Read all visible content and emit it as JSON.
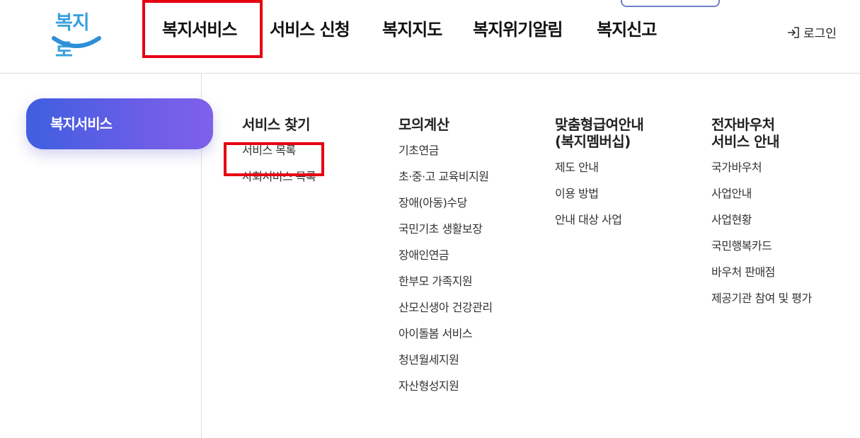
{
  "logo": {
    "text": "복지로",
    "colors": {
      "text": "#3aa0dd",
      "smile": "#2e8fd8"
    }
  },
  "gnb": {
    "items": [
      "복지서비스",
      "서비스 신청",
      "복지지도",
      "복지위기알림",
      "복지신고"
    ]
  },
  "login": {
    "label": "로그인",
    "icon": "login-arrow-icon"
  },
  "side": {
    "label": "복지서비스"
  },
  "columns": [
    {
      "title": "서비스 찾기",
      "items": [
        "서비스 목록",
        "사회서비스 목록"
      ]
    },
    {
      "title": "모의계산",
      "items": [
        "기초연금",
        "초·중·고 교육비지원",
        "장애(아동)수당",
        "국민기초 생활보장",
        "장애인연금",
        "한부모 가족지원",
        "산모신생아 건강관리",
        "아이돌봄 서비스",
        "청년월세지원",
        "자산형성지원"
      ]
    },
    {
      "title": "맞춤형급여안내\n(복지멤버십)",
      "items": [
        "제도 안내",
        "이용 방법",
        "안내 대상 사업"
      ]
    },
    {
      "title": "전자바우처\n서비스 안내",
      "items": [
        "국가바우처",
        "사업안내",
        "사업현황",
        "국민행복카드",
        "바우처 판매점",
        "제공기관 참여 및 평가"
      ]
    }
  ],
  "colors": {
    "highlight": "#e60012",
    "accent_start": "#3f5fe0",
    "accent_end": "#7f61ea"
  }
}
